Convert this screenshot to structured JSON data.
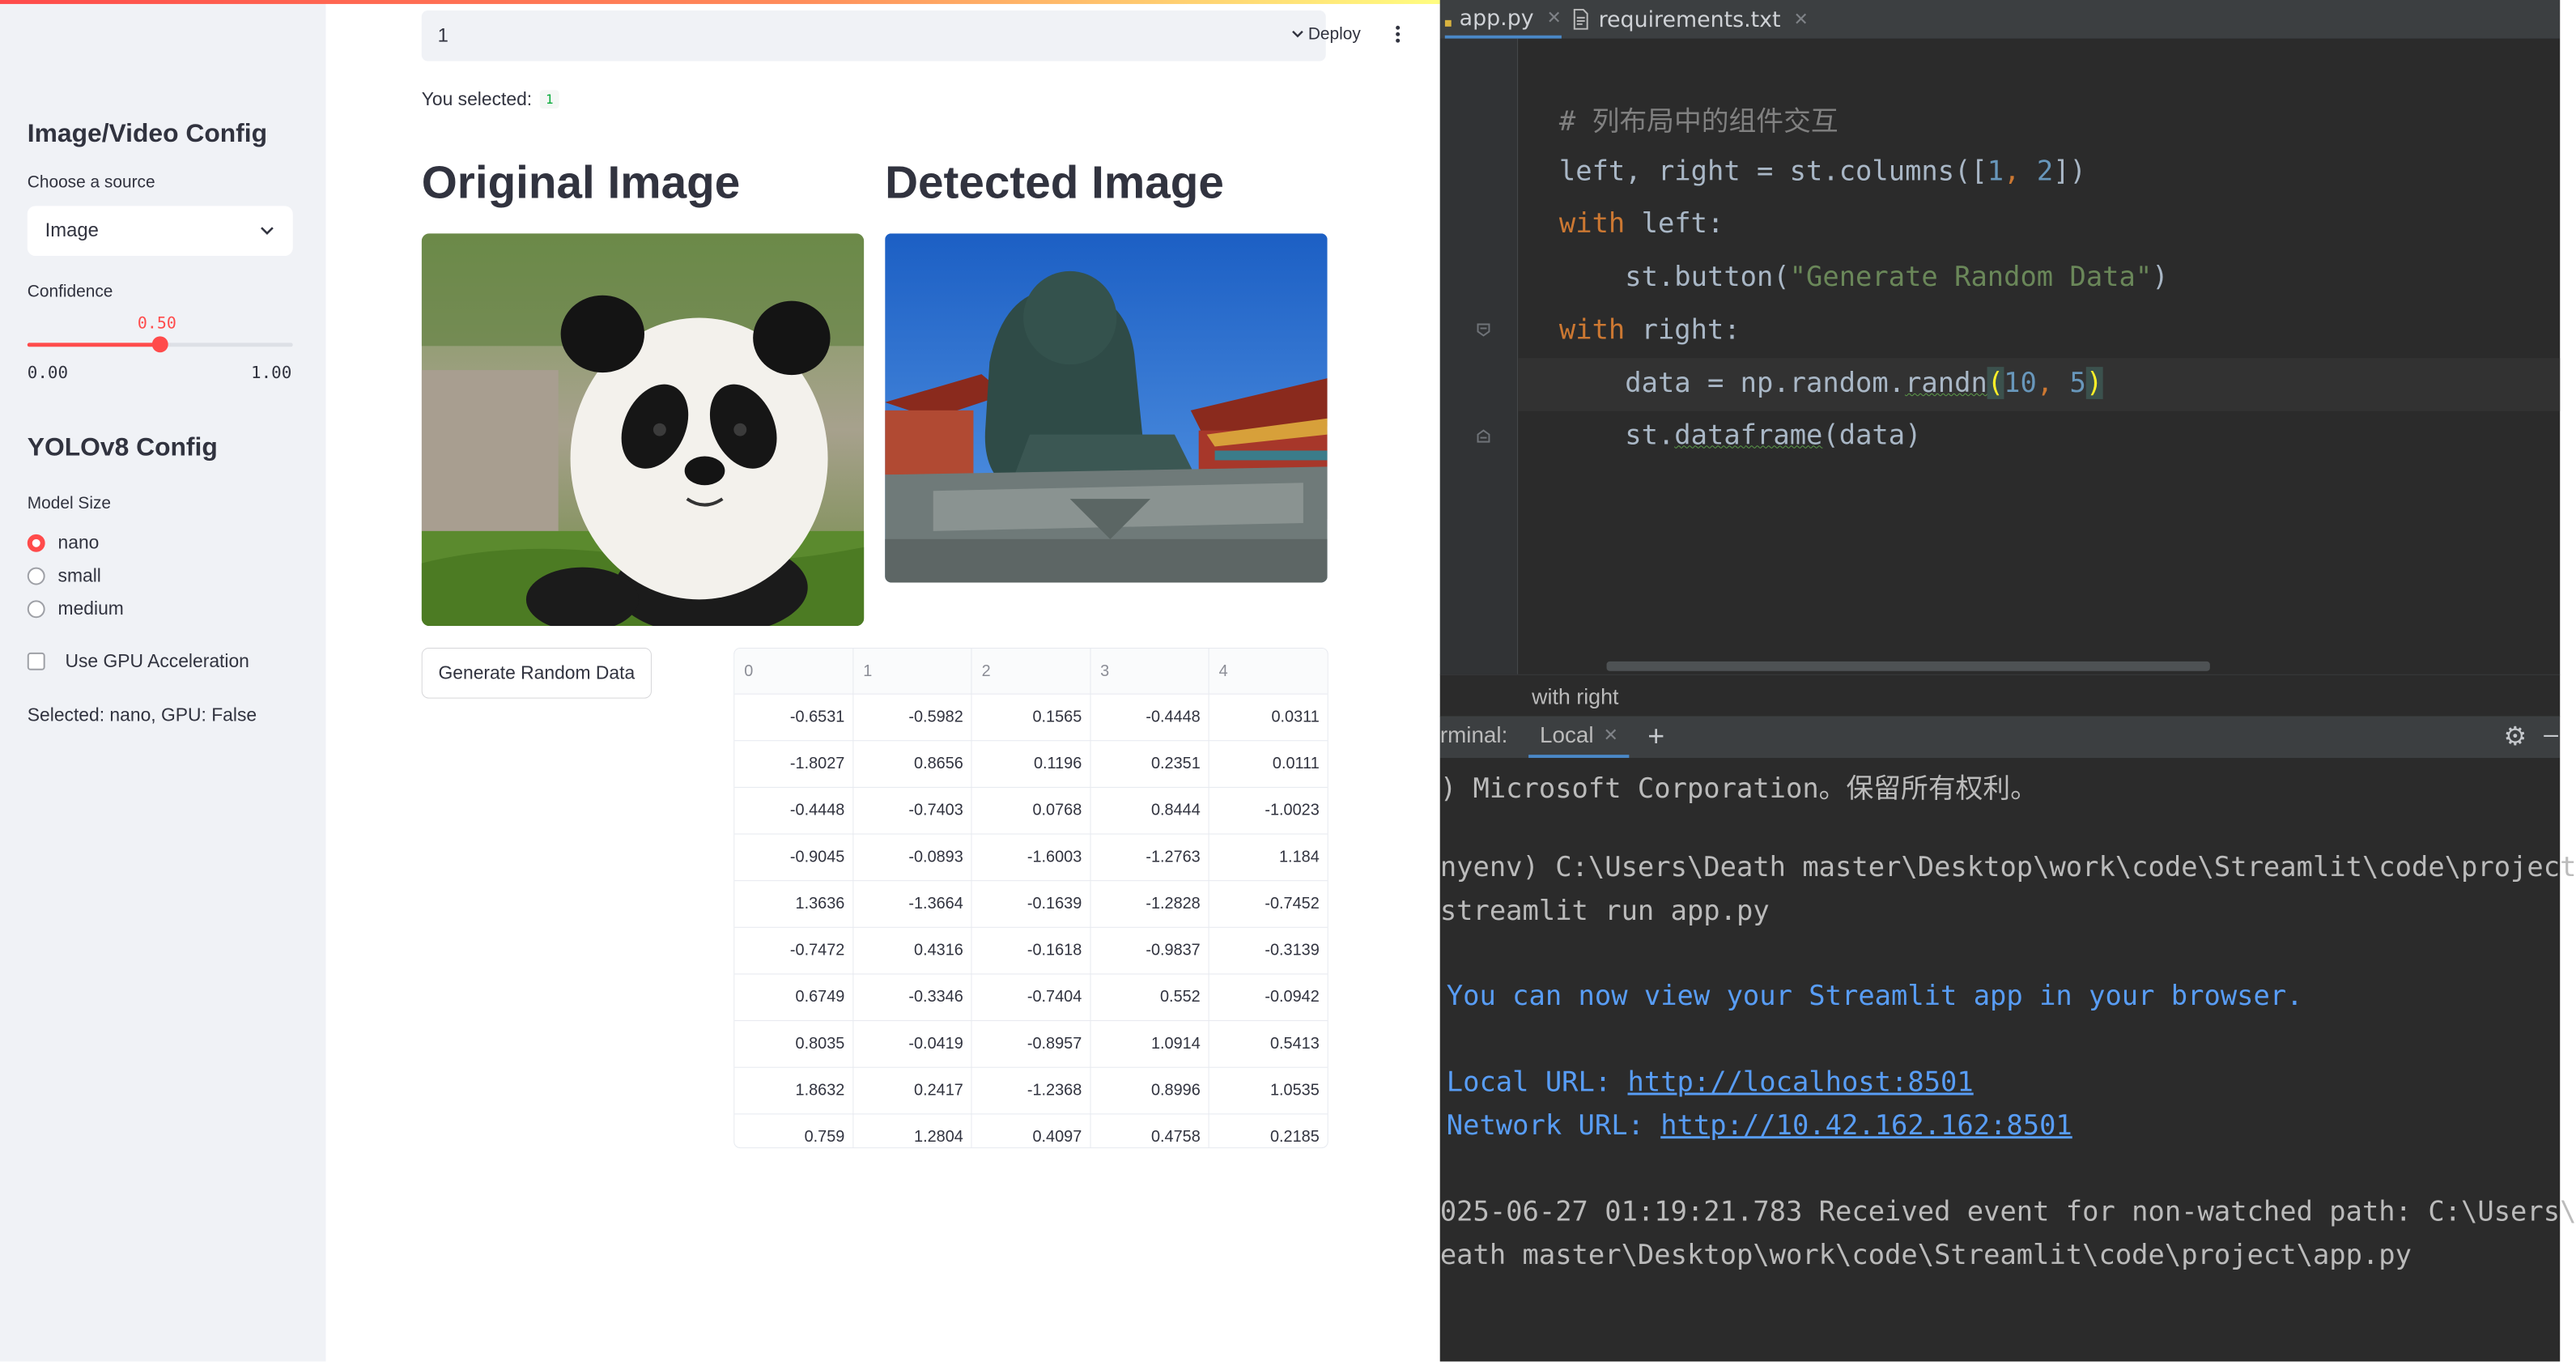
{
  "streamlit": {
    "top_input_value": "1",
    "deploy_label": "Deploy",
    "you_selected_label": "You selected:",
    "you_selected_value": "1",
    "sidebar": {
      "image_config_title": "Image/Video Config",
      "source_label": "Choose a source",
      "source_value": "Image",
      "confidence_label": "Confidence",
      "confidence_value": "0.50",
      "confidence_fraction": 0.5,
      "confidence_min": "0.00",
      "confidence_max": "1.00",
      "yolo_title": "YOLOv8 Config",
      "model_size_label": "Model Size",
      "model_options": [
        "nano",
        "small",
        "medium"
      ],
      "model_selected": "nano",
      "gpu_label": "Use GPU Acceleration",
      "selected_text": "Selected: nano, GPU: False"
    },
    "original_title": "Original Image",
    "detected_title": "Detected Image",
    "generate_button": "Generate Random Data",
    "dataframe": {
      "columns": [
        "0",
        "1",
        "2",
        "3",
        "4"
      ],
      "rows": [
        [
          "-0.6531",
          "-0.5982",
          "0.1565",
          "-0.4448",
          "0.0311"
        ],
        [
          "-1.8027",
          "0.8656",
          "0.1196",
          "0.2351",
          "0.0111"
        ],
        [
          "-0.4448",
          "-0.7403",
          "0.0768",
          "0.8444",
          "-1.0023"
        ],
        [
          "-0.9045",
          "-0.0893",
          "-1.6003",
          "-1.2763",
          "1.184"
        ],
        [
          "1.3636",
          "-1.3664",
          "-0.1639",
          "-1.2828",
          "-0.7452"
        ],
        [
          "-0.7472",
          "0.4316",
          "-0.1618",
          "-0.9837",
          "-0.3139"
        ],
        [
          "0.6749",
          "-0.3346",
          "-0.7404",
          "0.552",
          "-0.0942"
        ],
        [
          "0.8035",
          "-0.0419",
          "-0.8957",
          "1.0914",
          "0.5413"
        ],
        [
          "1.8632",
          "0.2417",
          "-1.2368",
          "0.8996",
          "1.0535"
        ],
        [
          "0.759",
          "1.2804",
          "0.4097",
          "0.4758",
          "0.2185"
        ]
      ]
    }
  },
  "ide": {
    "tabs": [
      "app.py",
      "requirements.txt"
    ],
    "code": {
      "comment": "# 列布局中的组件交互",
      "l1_a": "left, right = st.columns([",
      "l1_n1": "1",
      "l1_sep": ", ",
      "l1_n2": "2",
      "l1_end": "])",
      "l2_kw": "with",
      "l2_rest": " left:",
      "l3_a": "    st.button(",
      "l3_str": "\"Generate Random Data\"",
      "l3_end": ")",
      "l4_kw": "with",
      "l4_rest": " right:",
      "l5_a": "    data = np.random.",
      "l5_fn": "randn",
      "l5_open": "(",
      "l5_n1": "10",
      "l5_sep": ", ",
      "l5_n2": "5",
      "l5_close": ")",
      "l6_a": "    st.",
      "l6_fn": "dataframe",
      "l6_end": "(data)"
    },
    "breadcrumb": "with right",
    "terminal_label": "rminal:",
    "terminal_tab": "Local",
    "terminal_lines": {
      "l1": ") Microsoft Corporation。保留所有权利。",
      "l2": "nyenv) C:\\Users\\Death master\\Desktop\\work\\code\\Streamlit\\code\\project",
      "l3": "streamlit run app.py",
      "l4": "You can now view your Streamlit app in your browser.",
      "l5_label": "Local URL: ",
      "l5_url": "http://localhost:8501",
      "l6_label": "Network URL: ",
      "l6_url": "http://10.42.162.162:8501",
      "l7": "025-06-27 01:19:21.783 Received event for non-watched path: C:\\Users\\",
      "l8": "eath master\\Desktop\\work\\code\\Streamlit\\code\\project\\app.py"
    }
  },
  "colors": {
    "accent": "#ff4b4b",
    "sidebar_bg": "#f0f2f6",
    "ide_bg": "#2b2b2b",
    "terminal_link": "#589df6"
  }
}
